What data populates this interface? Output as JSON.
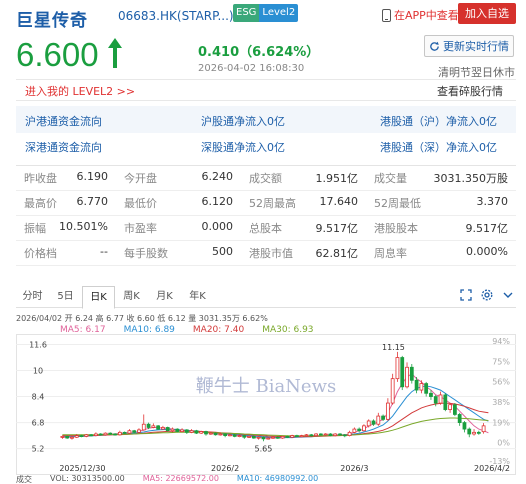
{
  "header": {
    "stock_name": "巨星传奇",
    "stock_code": "06683.HK(STARP...)",
    "esg_label": "ESG",
    "level2_label": "Level2",
    "app_link": "在APP中查看",
    "add_watch": "加入自选"
  },
  "quote": {
    "price": "6.600",
    "change": "0.410（6.624%）",
    "update_time": "2026-04-02 16:08:30",
    "refresh_label": "更新实时行情",
    "market_status": "清明节翌日休市",
    "level2_link": "进入我的 LEVEL2 >>",
    "ticks_link": "查看碎股行情"
  },
  "connect": {
    "row1": [
      "沪港通资金流向",
      "沪股通净流入0亿",
      "港股通（沪）净流入0亿"
    ],
    "row2": [
      "深港通资金流向",
      "深股通净流入0亿",
      "港股通（深）净流入0亿"
    ]
  },
  "stats": [
    [
      {
        "label": "昨收盘",
        "value": "6.190"
      },
      {
        "label": "今开盘",
        "value": "6.240"
      },
      {
        "label": "成交额",
        "value": "1.951亿"
      },
      {
        "label": "成交量",
        "value": "3031.350万股"
      }
    ],
    [
      {
        "label": "最高价",
        "value": "6.770"
      },
      {
        "label": "最低价",
        "value": "6.120"
      },
      {
        "label": "52周最高",
        "value": "17.640"
      },
      {
        "label": "52周最低",
        "value": "3.370"
      }
    ],
    [
      {
        "label": "振幅",
        "value": "10.501%"
      },
      {
        "label": "市盈率",
        "value": "0.000"
      },
      {
        "label": "总股本",
        "value": "9.517亿"
      },
      {
        "label": "港股股本",
        "value": "9.517亿"
      }
    ],
    [
      {
        "label": "价格档",
        "value": "--"
      },
      {
        "label": "每手股数",
        "value": "500"
      },
      {
        "label": "港股市值",
        "value": "62.81亿"
      },
      {
        "label": "周息率",
        "value": "0.000%"
      }
    ]
  ],
  "chart_tabs": [
    "分时",
    "5日",
    "日K",
    "周K",
    "月K",
    "年K"
  ],
  "active_tab": "日K",
  "ohlc": {
    "text": "2026/04/02  开 6.24  高 6.77  收 6.60  低 6.12  量 3031.35万  6.62%"
  },
  "ma": {
    "ma5": "MA5: 6.17",
    "ma10": "MA10: 6.89",
    "ma20": "MA20: 7.40",
    "ma30": "MA30: 6.93"
  },
  "volume_line": {
    "label": "成交",
    "vol": "VOL: 30313500.00",
    "ma5": "MA5: 22669572.00",
    "ma10": "MA10: 46980992.00"
  },
  "watermark": "鞭牛士 BiaNews",
  "colors": {
    "up": "#e03131",
    "down": "#1a9e3f",
    "ma5": "#e0639a",
    "ma10": "#2a8fd3",
    "ma20": "#d23a3a",
    "ma30": "#7aa82a"
  },
  "chart_data": {
    "type": "candlestick",
    "y_ticks": [
      "11.6",
      "10",
      "8.4",
      "6.8",
      "5.2"
    ],
    "y_tick_values": [
      11.6,
      10,
      8.4,
      6.8,
      5.2
    ],
    "pct_ticks": [
      "94%",
      "75%",
      "56%",
      "38%",
      "19%",
      "0%",
      "-13%"
    ],
    "ylim": [
      4.5,
      12.0
    ],
    "x_labels": [
      "2025/12/30",
      "2026/2",
      "2026/3",
      "2026/4/2"
    ],
    "annotations": {
      "high": "11.15",
      "low": "5.65"
    },
    "candles": [
      {
        "o": 5.9,
        "c": 5.95,
        "h": 6.0,
        "l": 5.8
      },
      {
        "o": 5.95,
        "c": 5.85,
        "h": 6.0,
        "l": 5.8
      },
      {
        "o": 5.85,
        "c": 5.9,
        "h": 6.0,
        "l": 5.75
      },
      {
        "o": 5.9,
        "c": 6.0,
        "h": 6.1,
        "l": 5.85
      },
      {
        "o": 6.0,
        "c": 5.95,
        "h": 6.05,
        "l": 5.9
      },
      {
        "o": 5.95,
        "c": 6.05,
        "h": 6.1,
        "l": 5.9
      },
      {
        "o": 6.05,
        "c": 6.0,
        "h": 6.1,
        "l": 5.95
      },
      {
        "o": 6.0,
        "c": 6.1,
        "h": 6.2,
        "l": 5.95
      },
      {
        "o": 6.1,
        "c": 6.05,
        "h": 6.15,
        "l": 6.0
      },
      {
        "o": 6.05,
        "c": 6.15,
        "h": 6.2,
        "l": 6.0
      },
      {
        "o": 6.15,
        "c": 6.1,
        "h": 6.2,
        "l": 6.05
      },
      {
        "o": 6.1,
        "c": 6.05,
        "h": 6.15,
        "l": 6.0
      },
      {
        "o": 6.05,
        "c": 6.2,
        "h": 6.3,
        "l": 6.0
      },
      {
        "o": 6.2,
        "c": 6.15,
        "h": 6.25,
        "l": 6.1
      },
      {
        "o": 6.15,
        "c": 6.3,
        "h": 6.4,
        "l": 6.1
      },
      {
        "o": 6.3,
        "c": 6.2,
        "h": 6.35,
        "l": 6.15
      },
      {
        "o": 6.2,
        "c": 6.35,
        "h": 6.45,
        "l": 6.15
      },
      {
        "o": 6.35,
        "c": 6.7,
        "h": 7.3,
        "l": 6.3
      },
      {
        "o": 6.7,
        "c": 6.5,
        "h": 6.8,
        "l": 6.4
      },
      {
        "o": 6.5,
        "c": 6.6,
        "h": 6.75,
        "l": 6.45
      },
      {
        "o": 6.6,
        "c": 6.4,
        "h": 6.65,
        "l": 6.35
      },
      {
        "o": 6.4,
        "c": 6.5,
        "h": 6.6,
        "l": 6.35
      },
      {
        "o": 6.5,
        "c": 6.3,
        "h": 6.55,
        "l": 6.25
      },
      {
        "o": 6.3,
        "c": 6.4,
        "h": 6.5,
        "l": 6.2
      },
      {
        "o": 6.4,
        "c": 6.25,
        "h": 6.45,
        "l": 6.2
      },
      {
        "o": 6.25,
        "c": 6.35,
        "h": 6.45,
        "l": 6.2
      },
      {
        "o": 6.35,
        "c": 6.2,
        "h": 6.4,
        "l": 6.1
      },
      {
        "o": 6.2,
        "c": 6.3,
        "h": 6.4,
        "l": 6.15
      },
      {
        "o": 6.3,
        "c": 6.15,
        "h": 6.35,
        "l": 6.1
      },
      {
        "o": 6.15,
        "c": 6.25,
        "h": 6.3,
        "l": 6.1
      },
      {
        "o": 6.25,
        "c": 6.1,
        "h": 6.3,
        "l": 6.0
      },
      {
        "o": 6.1,
        "c": 6.15,
        "h": 6.25,
        "l": 6.05
      },
      {
        "o": 6.15,
        "c": 6.05,
        "h": 6.2,
        "l": 6.0
      },
      {
        "o": 6.05,
        "c": 6.1,
        "h": 6.2,
        "l": 6.0
      },
      {
        "o": 6.1,
        "c": 6.0,
        "h": 6.15,
        "l": 5.9
      },
      {
        "o": 6.0,
        "c": 6.05,
        "h": 6.1,
        "l": 5.95
      },
      {
        "o": 6.05,
        "c": 5.95,
        "h": 6.1,
        "l": 5.9
      },
      {
        "o": 5.95,
        "c": 6.0,
        "h": 6.05,
        "l": 5.9
      },
      {
        "o": 6.0,
        "c": 5.9,
        "h": 6.05,
        "l": 5.8
      },
      {
        "o": 5.9,
        "c": 5.95,
        "h": 6.0,
        "l": 5.85
      },
      {
        "o": 5.95,
        "c": 5.85,
        "h": 6.0,
        "l": 5.8
      },
      {
        "o": 5.85,
        "c": 5.9,
        "h": 5.95,
        "l": 5.75
      },
      {
        "o": 5.9,
        "c": 5.8,
        "h": 5.95,
        "l": 5.65
      },
      {
        "o": 5.8,
        "c": 5.85,
        "h": 5.9,
        "l": 5.75
      },
      {
        "o": 5.85,
        "c": 5.9,
        "h": 5.95,
        "l": 5.8
      },
      {
        "o": 5.9,
        "c": 5.85,
        "h": 5.95,
        "l": 5.8
      },
      {
        "o": 5.85,
        "c": 5.95,
        "h": 6.0,
        "l": 5.8
      },
      {
        "o": 5.95,
        "c": 5.9,
        "h": 6.0,
        "l": 5.85
      },
      {
        "o": 5.9,
        "c": 6.0,
        "h": 6.05,
        "l": 5.85
      },
      {
        "o": 6.0,
        "c": 5.95,
        "h": 6.05,
        "l": 5.9
      },
      {
        "o": 5.95,
        "c": 6.0,
        "h": 6.05,
        "l": 5.9
      },
      {
        "o": 6.0,
        "c": 6.05,
        "h": 6.1,
        "l": 5.95
      },
      {
        "o": 6.05,
        "c": 6.0,
        "h": 6.1,
        "l": 5.95
      },
      {
        "o": 6.0,
        "c": 6.1,
        "h": 6.15,
        "l": 5.95
      },
      {
        "o": 6.1,
        "c": 6.05,
        "h": 6.15,
        "l": 6.0
      },
      {
        "o": 6.05,
        "c": 6.1,
        "h": 6.15,
        "l": 6.0
      },
      {
        "o": 6.1,
        "c": 6.0,
        "h": 6.15,
        "l": 5.95
      },
      {
        "o": 6.0,
        "c": 6.1,
        "h": 6.15,
        "l": 5.95
      },
      {
        "o": 6.1,
        "c": 6.05,
        "h": 6.15,
        "l": 6.0
      },
      {
        "o": 6.05,
        "c": 6.0,
        "h": 6.1,
        "l": 5.9
      },
      {
        "o": 6.0,
        "c": 6.2,
        "h": 6.3,
        "l": 5.95
      },
      {
        "o": 6.2,
        "c": 6.4,
        "h": 6.5,
        "l": 6.15
      },
      {
        "o": 6.4,
        "c": 6.3,
        "h": 6.5,
        "l": 6.2
      },
      {
        "o": 6.3,
        "c": 6.6,
        "h": 6.7,
        "l": 6.25
      },
      {
        "o": 6.6,
        "c": 6.9,
        "h": 7.0,
        "l": 6.5
      },
      {
        "o": 6.9,
        "c": 6.7,
        "h": 7.0,
        "l": 6.6
      },
      {
        "o": 6.7,
        "c": 7.2,
        "h": 7.4,
        "l": 6.6
      },
      {
        "o": 7.2,
        "c": 7.0,
        "h": 7.3,
        "l": 6.9
      },
      {
        "o": 7.0,
        "c": 8.0,
        "h": 8.3,
        "l": 6.9
      },
      {
        "o": 8.0,
        "c": 9.5,
        "h": 9.8,
        "l": 7.9
      },
      {
        "o": 9.5,
        "c": 10.8,
        "h": 11.15,
        "l": 9.3
      },
      {
        "o": 10.8,
        "c": 9.0,
        "h": 10.9,
        "l": 8.8
      },
      {
        "o": 9.0,
        "c": 10.2,
        "h": 10.5,
        "l": 8.9
      },
      {
        "o": 10.2,
        "c": 9.4,
        "h": 10.4,
        "l": 9.2
      },
      {
        "o": 9.4,
        "c": 8.8,
        "h": 9.6,
        "l": 8.6
      },
      {
        "o": 8.8,
        "c": 9.2,
        "h": 9.4,
        "l": 8.6
      },
      {
        "o": 9.2,
        "c": 8.6,
        "h": 9.3,
        "l": 8.4
      },
      {
        "o": 8.6,
        "c": 8.4,
        "h": 8.8,
        "l": 8.2
      },
      {
        "o": 8.4,
        "c": 8.0,
        "h": 8.5,
        "l": 7.8
      },
      {
        "o": 8.0,
        "c": 8.5,
        "h": 8.7,
        "l": 7.9
      },
      {
        "o": 8.5,
        "c": 7.6,
        "h": 8.6,
        "l": 7.5
      },
      {
        "o": 7.6,
        "c": 7.9,
        "h": 8.0,
        "l": 7.4
      },
      {
        "o": 7.9,
        "c": 7.3,
        "h": 8.0,
        "l": 7.2
      },
      {
        "o": 7.3,
        "c": 6.8,
        "h": 7.4,
        "l": 6.6
      },
      {
        "o": 6.8,
        "c": 6.4,
        "h": 6.9,
        "l": 6.2
      },
      {
        "o": 6.4,
        "c": 6.1,
        "h": 6.5,
        "l": 5.9
      },
      {
        "o": 6.1,
        "c": 6.2,
        "h": 6.4,
        "l": 6.0
      },
      {
        "o": 6.2,
        "c": 6.19,
        "h": 6.3,
        "l": 6.05
      },
      {
        "o": 6.24,
        "c": 6.6,
        "h": 6.77,
        "l": 6.12
      }
    ],
    "ma_series": [
      {
        "name": "MA5",
        "values": [
          5.9,
          5.9,
          5.9,
          5.95,
          5.95,
          6.0,
          6.0,
          6.05,
          6.05,
          6.1,
          6.1,
          6.1,
          6.15,
          6.15,
          6.2,
          6.2,
          6.25,
          6.35,
          6.45,
          6.5,
          6.5,
          6.45,
          6.45,
          6.4,
          6.35,
          6.3,
          6.3,
          6.25,
          6.25,
          6.2,
          6.2,
          6.15,
          6.1,
          6.1,
          6.05,
          6.05,
          6.0,
          6.0,
          5.95,
          5.95,
          5.9,
          5.9,
          5.85,
          5.85,
          5.85,
          5.85,
          5.85,
          5.9,
          5.9,
          5.95,
          5.95,
          5.95,
          6.0,
          6.0,
          6.0,
          6.05,
          6.05,
          6.05,
          6.05,
          6.05,
          6.1,
          6.2,
          6.3,
          6.4,
          6.6,
          6.7,
          6.85,
          7.0,
          7.4,
          8.0,
          8.7,
          9.2,
          9.6,
          9.8,
          9.5,
          9.3,
          9.0,
          8.8,
          8.5,
          8.4,
          8.2,
          8.0,
          7.8,
          7.5,
          7.2,
          6.9,
          6.6,
          6.4,
          6.3,
          6.17
        ]
      },
      {
        "name": "MA10",
        "values": [
          5.95,
          5.95,
          5.95,
          5.95,
          5.95,
          5.97,
          5.98,
          6.0,
          6.02,
          6.03,
          6.05,
          6.07,
          6.08,
          6.1,
          6.12,
          6.15,
          6.18,
          6.22,
          6.28,
          6.32,
          6.35,
          6.37,
          6.38,
          6.38,
          6.37,
          6.35,
          6.33,
          6.3,
          6.28,
          6.25,
          6.22,
          6.2,
          6.17,
          6.15,
          6.12,
          6.1,
          6.07,
          6.05,
          6.02,
          6.0,
          5.97,
          5.95,
          5.93,
          5.91,
          5.9,
          5.89,
          5.88,
          5.88,
          5.88,
          5.9,
          5.91,
          5.92,
          5.93,
          5.95,
          5.97,
          5.98,
          6.0,
          6.01,
          6.02,
          6.03,
          6.05,
          6.1,
          6.15,
          6.22,
          6.3,
          6.4,
          6.52,
          6.65,
          6.9,
          7.2,
          7.6,
          8.0,
          8.4,
          8.7,
          8.9,
          9.0,
          9.05,
          9.0,
          8.9,
          8.8,
          8.6,
          8.4,
          8.2,
          8.0,
          7.8,
          7.6,
          7.4,
          7.2,
          7.0,
          6.89
        ]
      },
      {
        "name": "MA20",
        "values": [
          6.0,
          6.0,
          6.0,
          6.0,
          6.0,
          6.0,
          6.0,
          6.01,
          6.02,
          6.03,
          6.04,
          6.05,
          6.06,
          6.07,
          6.08,
          6.1,
          6.12,
          6.14,
          6.17,
          6.2,
          6.22,
          6.24,
          6.26,
          6.27,
          6.28,
          6.28,
          6.28,
          6.27,
          6.26,
          6.25,
          6.24,
          6.22,
          6.2,
          6.18,
          6.16,
          6.14,
          6.12,
          6.1,
          6.07,
          6.05,
          6.03,
          6.01,
          5.99,
          5.97,
          5.96,
          5.95,
          5.94,
          5.93,
          5.93,
          5.93,
          5.93,
          5.94,
          5.94,
          5.95,
          5.96,
          5.97,
          5.98,
          5.99,
          6.0,
          6.01,
          6.03,
          6.05,
          6.08,
          6.12,
          6.16,
          6.2,
          6.26,
          6.33,
          6.45,
          6.6,
          6.8,
          7.0,
          7.2,
          7.4,
          7.55,
          7.7,
          7.8,
          7.88,
          7.94,
          7.98,
          8.0,
          7.98,
          7.94,
          7.88,
          7.8,
          7.7,
          7.6,
          7.5,
          7.45,
          7.4
        ]
      },
      {
        "name": "MA30",
        "values": [
          6.05,
          6.05,
          6.05,
          6.05,
          6.05,
          6.05,
          6.05,
          6.05,
          6.06,
          6.06,
          6.07,
          6.07,
          6.08,
          6.08,
          6.09,
          6.1,
          6.11,
          6.12,
          6.13,
          6.15,
          6.16,
          6.17,
          6.18,
          6.19,
          6.2,
          6.2,
          6.2,
          6.2,
          6.2,
          6.2,
          6.19,
          6.18,
          6.17,
          6.16,
          6.15,
          6.14,
          6.13,
          6.12,
          6.1,
          6.09,
          6.07,
          6.06,
          6.05,
          6.03,
          6.02,
          6.01,
          6.0,
          5.99,
          5.98,
          5.98,
          5.98,
          5.98,
          5.98,
          5.98,
          5.99,
          5.99,
          6.0,
          6.0,
          6.01,
          6.02,
          6.03,
          6.04,
          6.06,
          6.08,
          6.1,
          6.13,
          6.16,
          6.2,
          6.26,
          6.33,
          6.42,
          6.52,
          6.62,
          6.72,
          6.8,
          6.87,
          6.93,
          6.98,
          7.02,
          7.05,
          7.07,
          7.08,
          7.08,
          7.07,
          7.05,
          7.03,
          7.0,
          6.97,
          6.95,
          6.93
        ]
      }
    ]
  }
}
